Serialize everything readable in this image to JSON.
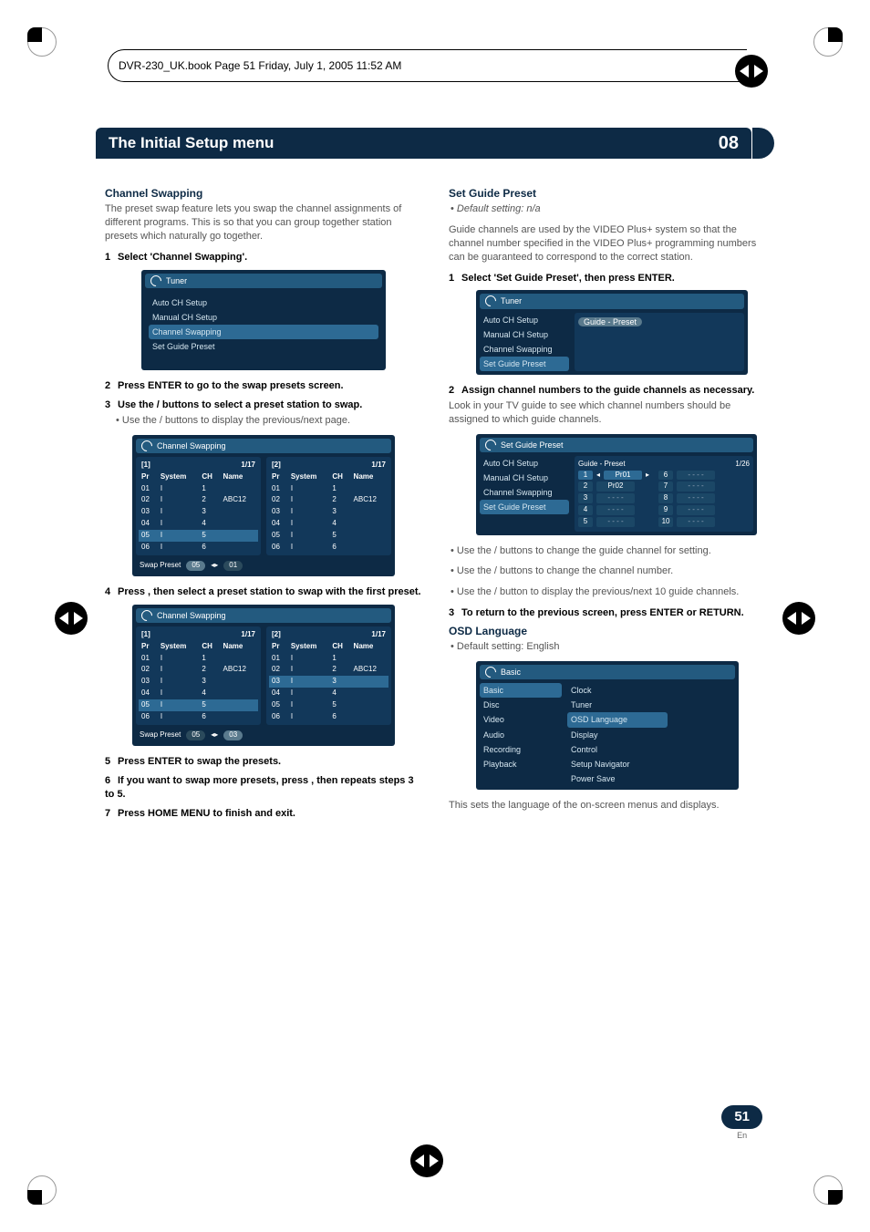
{
  "filepath": "DVR-230_UK.book  Page 51  Friday, July 1, 2005  11:52 AM",
  "header": {
    "title": "The Initial Setup menu",
    "chapter": "08"
  },
  "left": {
    "h_chswap": "Channel Swapping",
    "p_chswap": "The preset swap feature lets you swap the channel assignments of different programs. This is so that you can group together station presets which naturally go together.",
    "s1": {
      "n": "1",
      "t": "Select 'Channel Swapping'."
    },
    "tuner_panel": {
      "title": "Tuner",
      "items": [
        "Auto CH Setup",
        "Manual CH Setup",
        "Channel Swapping",
        "Set Guide Preset"
      ],
      "selected": 2
    },
    "s2": {
      "n": "2",
      "t": "Press ENTER to go to the swap presets screen."
    },
    "s3": {
      "n": "3",
      "t": "Use the  / buttons to select a preset station to swap."
    },
    "s3_note": "Use the / buttons to display the previous/next page.",
    "table1": {
      "title": "Channel Swapping",
      "pager": "1/17",
      "cols": [
        "Pr",
        "System",
        "CH",
        "Name"
      ],
      "left": [
        {
          "pr": "01",
          "sys": "I",
          "ch": "1",
          "name": ""
        },
        {
          "pr": "02",
          "sys": "I",
          "ch": "2",
          "name": "ABC12"
        },
        {
          "pr": "03",
          "sys": "I",
          "ch": "3",
          "name": ""
        },
        {
          "pr": "04",
          "sys": "I",
          "ch": "4",
          "name": ""
        },
        {
          "pr": "05",
          "sys": "I",
          "ch": "5",
          "name": ""
        },
        {
          "pr": "06",
          "sys": "I",
          "ch": "6",
          "name": ""
        }
      ],
      "right": [
        {
          "pr": "01",
          "sys": "I",
          "ch": "1",
          "name": ""
        },
        {
          "pr": "02",
          "sys": "I",
          "ch": "2",
          "name": "ABC12"
        },
        {
          "pr": "03",
          "sys": "I",
          "ch": "3",
          "name": ""
        },
        {
          "pr": "04",
          "sys": "I",
          "ch": "4",
          "name": ""
        },
        {
          "pr": "05",
          "sys": "I",
          "ch": "5",
          "name": ""
        },
        {
          "pr": "06",
          "sys": "I",
          "ch": "6",
          "name": ""
        }
      ],
      "hl_l": 4,
      "hl_r": -1,
      "swap": {
        "label": "Swap Preset",
        "a": "05",
        "b": "01"
      }
    },
    "s4": {
      "n": "4",
      "t": "Press , then select a preset station to swap with the first preset."
    },
    "table2": {
      "title": "Channel Swapping",
      "pager": "1/17",
      "hl_l": 4,
      "hl_r": 2,
      "swap": {
        "label": "Swap Preset",
        "a": "05",
        "b": "03"
      }
    },
    "s5": {
      "n": "5",
      "t": "Press ENTER to swap the presets."
    },
    "s6": {
      "n": "6",
      "t": "If you want to swap more presets, press , then repeats steps 3 to 5."
    },
    "s7": {
      "n": "7",
      "t": "Press HOME MENU to finish and exit."
    }
  },
  "right": {
    "h_sgp": "Set Guide Preset",
    "sgp_default": "Default setting: n/a",
    "sgp_p": "Guide channels are used by the VIDEO Plus+ system so that the channel number specified in the VIDEO Plus+ programming numbers can be guaranteed to correspond to the correct station.",
    "sgp_s1": {
      "n": "1",
      "t": "Select 'Set Guide Preset', then press ENTER."
    },
    "tuner_panel2": {
      "title": "Tuner",
      "left": [
        "Auto CH Setup",
        "Manual CH Setup",
        "Channel Swapping",
        "Set Guide Preset"
      ],
      "left_sel": 3,
      "right_label": "Guide - Preset"
    },
    "sgp_s2": {
      "n": "2",
      "t": "Assign channel numbers to the guide channels as necessary."
    },
    "sgp_p2": "Look in your TV guide to see which channel numbers should be assigned to which guide channels.",
    "gp_panel": {
      "title": "Set Guide Preset",
      "left": [
        "Auto CH Setup",
        "Manual CH Setup",
        "Channel Swapping",
        "Set Guide Preset"
      ],
      "left_sel": 3,
      "header": "Guide - Preset",
      "pager": "1/26",
      "rows": [
        {
          "g": "1",
          "p": "Pr01"
        },
        {
          "g": "6",
          "p": "- - - -"
        },
        {
          "g": "2",
          "p": "Pr02"
        },
        {
          "g": "7",
          "p": "- - - -"
        },
        {
          "g": "3",
          "p": "- - - -"
        },
        {
          "g": "8",
          "p": "- - - -"
        },
        {
          "g": "4",
          "p": "- - - -"
        },
        {
          "g": "9",
          "p": "- - - -"
        },
        {
          "g": "5",
          "p": "- - - -"
        },
        {
          "g": "10",
          "p": "- - - -"
        }
      ]
    },
    "b1": "Use the / buttons to change the guide channel for setting.",
    "b2": "Use the / buttons to change the channel number.",
    "b3": "Use the / button to display the previous/next 10 guide channels.",
    "sgp_s3": {
      "n": "3",
      "t": "To return to the previous screen, press ENTER or RETURN."
    },
    "h_osd": "OSD Language",
    "osd_default": "Default setting: English",
    "basic_panel": {
      "title": "Basic",
      "left": [
        "Basic",
        "Disc",
        "Video",
        "Audio",
        "Recording",
        "Playback"
      ],
      "left_sel": 0,
      "right": [
        "Clock",
        "Tuner",
        "OSD Language",
        "Display",
        "Control",
        "Setup Navigator",
        "Power Save"
      ],
      "right_sel": 2
    },
    "osd_p": "This sets the language of the on-screen menus and displays."
  },
  "pagenum": "51",
  "lang": "En"
}
